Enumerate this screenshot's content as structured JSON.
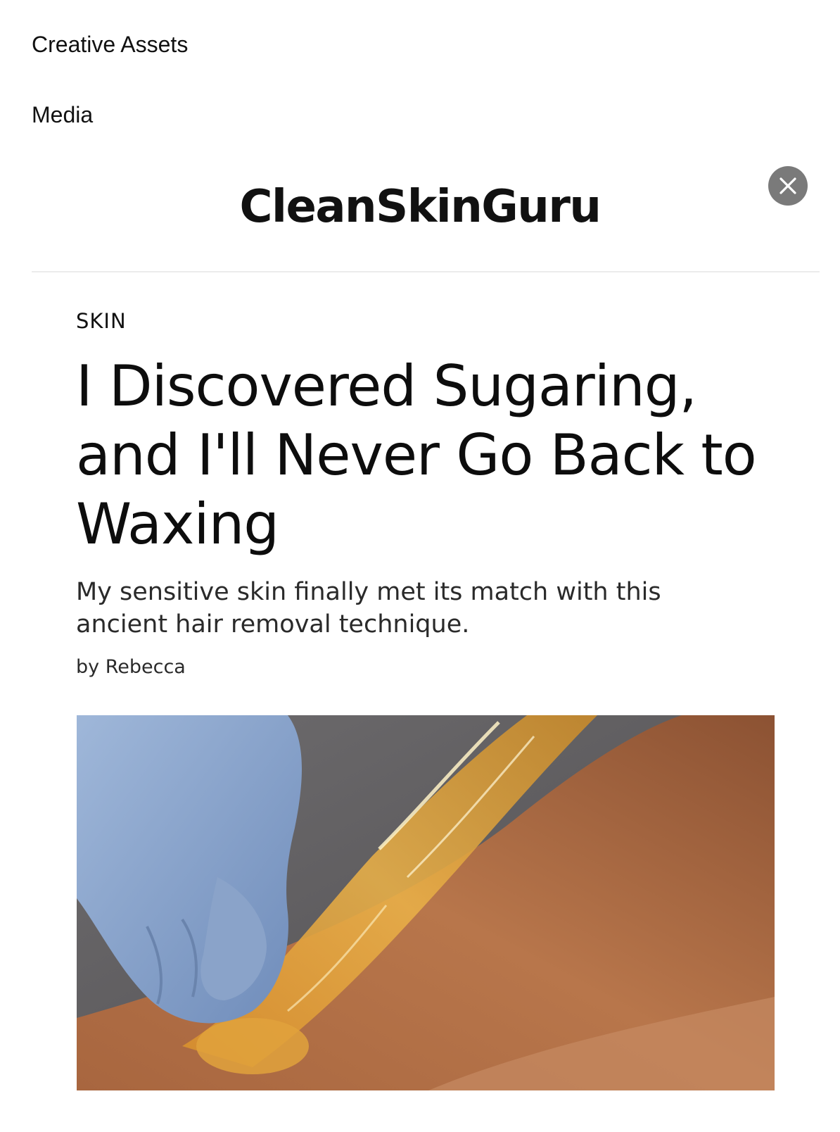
{
  "nav": {
    "creative_assets": "Creative Assets",
    "media": "Media"
  },
  "header": {
    "brand": "CleanSkinGuru",
    "close_icon": "close-icon"
  },
  "article": {
    "category": "SKIN",
    "title": "I Discovered Sugaring, and I'll Never Go Back to Waxing",
    "subtitle": "My sensitive skin finally met its match with this ancient hair removal technique.",
    "byline": "by Rebecca",
    "hero_image": "sugaring-hair-removal-photo"
  },
  "colors": {
    "close_button_bg": "#7a7a7a",
    "divider": "#ececec",
    "text": "#111111"
  }
}
